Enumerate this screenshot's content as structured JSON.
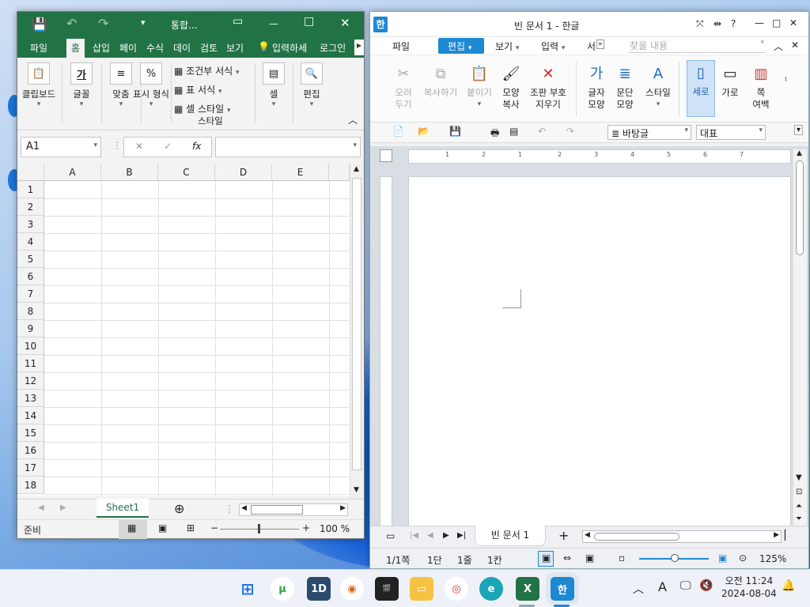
{
  "excel": {
    "title": "통합...",
    "menu": [
      "파일",
      "홈",
      "삽입",
      "페이",
      "수식",
      "데이",
      "검토",
      "보기"
    ],
    "tell_me": "입력하세",
    "login": "로그인",
    "ribbon": {
      "clipboard": "클립보드",
      "font": "글꼴",
      "align": "맞춤",
      "number": "표시 형식",
      "cond_format": "조건부 서식",
      "table_format": "표 서식",
      "cell_style": "셀 스타일",
      "style_group": "스타일",
      "cells": "셀",
      "edit": "편집"
    },
    "name_box": "A1",
    "fx": "fx",
    "columns": [
      "A",
      "B",
      "C",
      "D",
      "E"
    ],
    "rows": [
      "1",
      "2",
      "3",
      "4",
      "5",
      "6",
      "7",
      "8",
      "9",
      "10",
      "11",
      "12",
      "13",
      "14",
      "15",
      "16",
      "17",
      "18"
    ],
    "sheet_tab": "Sheet1",
    "status_ready": "준비",
    "zoom": "100 %"
  },
  "hwp": {
    "title": "빈 문서 1 - 한글",
    "menu": [
      "파일",
      "편집",
      "보기",
      "입력",
      "서"
    ],
    "search_placeholder": "찾을 내용",
    "ribbon": [
      {
        "line1": "오려",
        "line2": "두기"
      },
      {
        "line1": "복사하기",
        "line2": ""
      },
      {
        "line1": "붙이기",
        "line2": ""
      },
      {
        "line1": "모양",
        "line2": "복사"
      },
      {
        "line1": "조판 부호",
        "line2": "지우기"
      },
      {
        "line1": "글자",
        "line2": "모양"
      },
      {
        "line1": "문단",
        "line2": "모양"
      },
      {
        "line1": "스타일",
        "line2": ""
      },
      {
        "line1": "세로",
        "line2": ""
      },
      {
        "line1": "가로",
        "line2": ""
      },
      {
        "line1": "쪽",
        "line2": "여백"
      }
    ],
    "style_select": "바탕글",
    "font_select": "대표",
    "ruler_marks": [
      "1",
      "2",
      "1",
      "2",
      "3",
      "4",
      "5",
      "6",
      "7"
    ],
    "doc_tab": "빈 문서 1",
    "status": {
      "page": "1/1쪽",
      "section": "1단",
      "line": "1줄",
      "column": "1칸",
      "zoom": "125%"
    }
  },
  "taskbar": {
    "time": "오전 11:24",
    "date": "2024-08-04",
    "ime": "A"
  },
  "colors": {
    "excel_green": "#217346",
    "hwp_blue": "#1e88d2",
    "taskbar": "#eef2f8"
  }
}
